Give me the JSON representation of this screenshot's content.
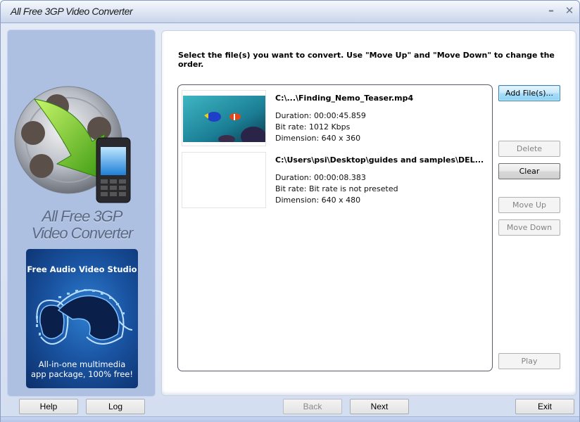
{
  "window": {
    "title": "All Free 3GP Video Converter",
    "minimize_icon": "minimize-icon",
    "close_icon": "close-icon"
  },
  "sidebar": {
    "logo_icon": "film-reel-phone-logo",
    "logo_line1": "All Free 3GP",
    "logo_line2": "Video Converter",
    "promo": {
      "title": "Free Audio Video Studio",
      "subtitle_line1": "All-in-one multimedia",
      "subtitle_line2": "app package, 100% free!",
      "icon": "film-strip-icon"
    }
  },
  "main": {
    "instruction": "Select the file(s) you want to convert. Use \"Move Up\" and \"Move Down\" to change the order.",
    "files": [
      {
        "name": "C:\\...\\Finding_Nemo_Teaser.mp4",
        "duration": "Duration: 00:00:45.859",
        "bitrate": "Bit rate: 1012 Kbps",
        "dimension": "Dimension: 640 x 360",
        "thumbnail": "underwater-fish-thumbnail"
      },
      {
        "name": "C:\\Users\\psi\\Desktop\\guides and samples\\DEL...",
        "duration": "Duration: 00:00:08.383",
        "bitrate": "Bit rate: Bit rate is not preseted",
        "dimension": "Dimension: 640 x 480",
        "thumbnail": "blank-thumbnail"
      }
    ],
    "buttons": {
      "add": "Add File(s)...",
      "delete": "Delete",
      "clear": "Clear",
      "move_up": "Move Up",
      "move_down": "Move Down",
      "play": "Play"
    }
  },
  "footer": {
    "help": "Help",
    "log": "Log",
    "back": "Back",
    "next": "Next",
    "exit": "Exit"
  }
}
